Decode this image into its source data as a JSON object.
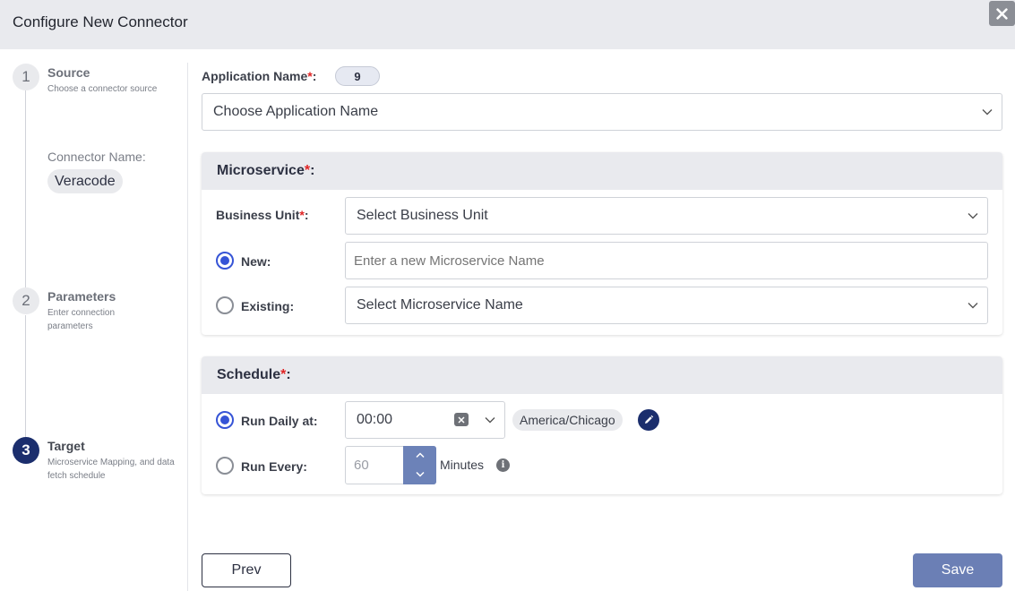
{
  "window": {
    "title": "Configure New Connector"
  },
  "stepper": {
    "steps": [
      {
        "number": "1",
        "title": "Source",
        "subtitle": "Choose a connector source"
      },
      {
        "number": "2",
        "title": "Parameters",
        "subtitle": "Enter connection parameters"
      },
      {
        "number": "3",
        "title": "Target",
        "subtitle": "Microservice Mapping, and data fetch schedule"
      }
    ],
    "connector_name_label": "Connector Name:",
    "connector_name_value": "Veracode"
  },
  "application": {
    "label": "Application Name",
    "required_mark": "*",
    "colon": ":",
    "count_badge": "9",
    "select_placeholder": "Choose Application Name"
  },
  "microservice": {
    "header": "Microservice",
    "required_mark": "*",
    "colon": ":",
    "business_unit_label": "Business Unit",
    "business_unit_placeholder": "Select Business Unit",
    "new_label": "New:",
    "new_placeholder": "Enter a new Microservice Name",
    "existing_label": "Existing:",
    "existing_placeholder": "Select Microservice Name",
    "selected_option": "new"
  },
  "schedule": {
    "header": "Schedule",
    "required_mark": "*",
    "colon": ":",
    "run_daily_label": "Run Daily at:",
    "run_daily_time": "00:00",
    "timezone": "America/Chicago",
    "run_every_label": "Run Every:",
    "run_every_value": "60",
    "run_every_unit": "Minutes",
    "selected_option": "daily"
  },
  "footer": {
    "prev_label": "Prev",
    "save_label": "Save"
  },
  "colors": {
    "primary_navy": "#1b2e6d",
    "radio_blue": "#3654d6",
    "save_button": "#6b7fb5",
    "required_red": "#e02424"
  }
}
